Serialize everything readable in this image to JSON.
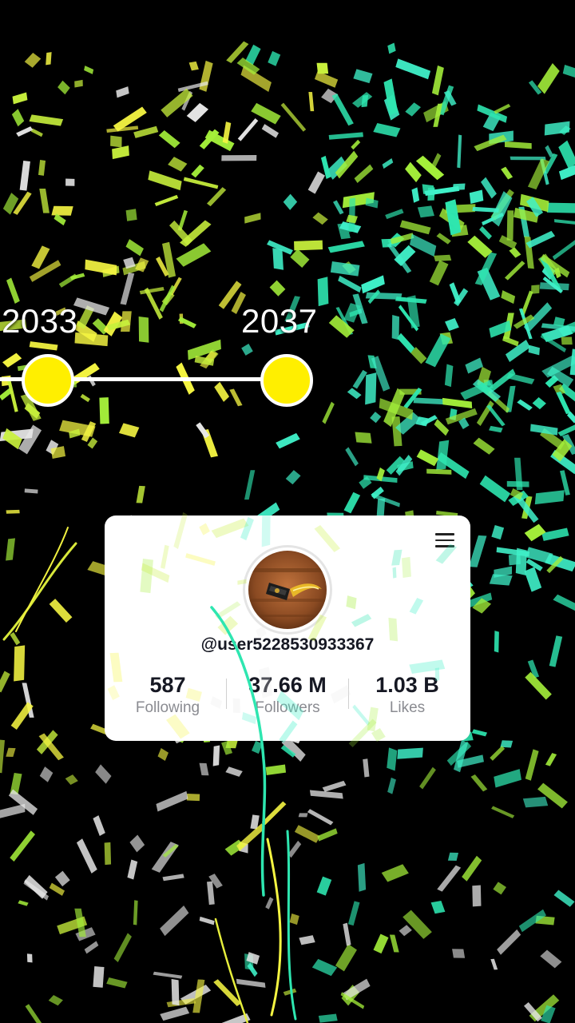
{
  "timeline": {
    "years": [
      "2033",
      "2037"
    ]
  },
  "profile": {
    "username": "@user5228530933367",
    "stats": [
      {
        "value": "587",
        "label": "Following"
      },
      {
        "value": "37.66 M",
        "label": "Followers"
      },
      {
        "value": "1.03 B",
        "label": "Likes"
      }
    ]
  },
  "icons": {
    "menu": "hamburger-menu-icon",
    "avatar": "karambit-knife-avatar"
  },
  "colors": {
    "background": "#000000",
    "timeline_dot": "#ffef00",
    "confetti": [
      "#f5f542",
      "#c8f03c",
      "#3ff0c8",
      "#2ee6b0",
      "#a4ef3a",
      "#e8e8e8"
    ]
  }
}
